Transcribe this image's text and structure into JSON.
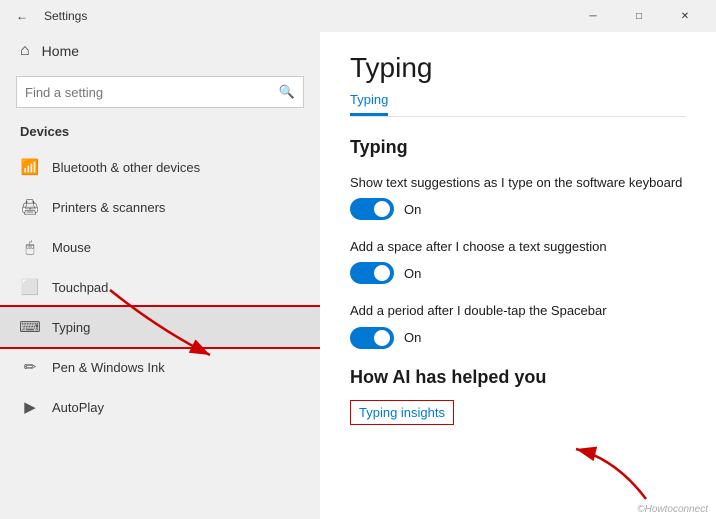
{
  "titlebar": {
    "back_label": "←",
    "title": "Settings",
    "min_label": "─",
    "max_label": "□",
    "close_label": "✕"
  },
  "sidebar": {
    "home_label": "Home",
    "search_placeholder": "Find a setting",
    "section_title": "Devices",
    "items": [
      {
        "id": "bluetooth",
        "label": "Bluetooth & other devices",
        "icon": "📶"
      },
      {
        "id": "printers",
        "label": "Printers & scanners",
        "icon": "🖨"
      },
      {
        "id": "mouse",
        "label": "Mouse",
        "icon": "🖱"
      },
      {
        "id": "touchpad",
        "label": "Touchpad",
        "icon": "⬜"
      },
      {
        "id": "typing",
        "label": "Typing",
        "icon": "⌨",
        "active": true
      },
      {
        "id": "pen",
        "label": "Pen & Windows Ink",
        "icon": "✏"
      },
      {
        "id": "autoplay",
        "label": "AutoPlay",
        "icon": "▶"
      }
    ]
  },
  "main": {
    "page_title": "Typing",
    "tabs": [
      {
        "id": "typing",
        "label": "Typing",
        "active": true
      },
      {
        "id": "other",
        "label": "..."
      }
    ],
    "typing_section": {
      "title": "Typing",
      "settings": [
        {
          "id": "text-suggestions",
          "label": "Show text suggestions as I type on the software keyboard",
          "state": "On",
          "enabled": true
        },
        {
          "id": "space-after",
          "label": "Add a space after I choose a text suggestion",
          "state": "On",
          "enabled": true
        },
        {
          "id": "period",
          "label": "Add a period after I double-tap the Spacebar",
          "state": "On",
          "enabled": true
        }
      ]
    },
    "ai_section": {
      "title": "How AI has helped you",
      "insights_label": "Typing insights"
    }
  },
  "watermark": "©Howtoconnect"
}
